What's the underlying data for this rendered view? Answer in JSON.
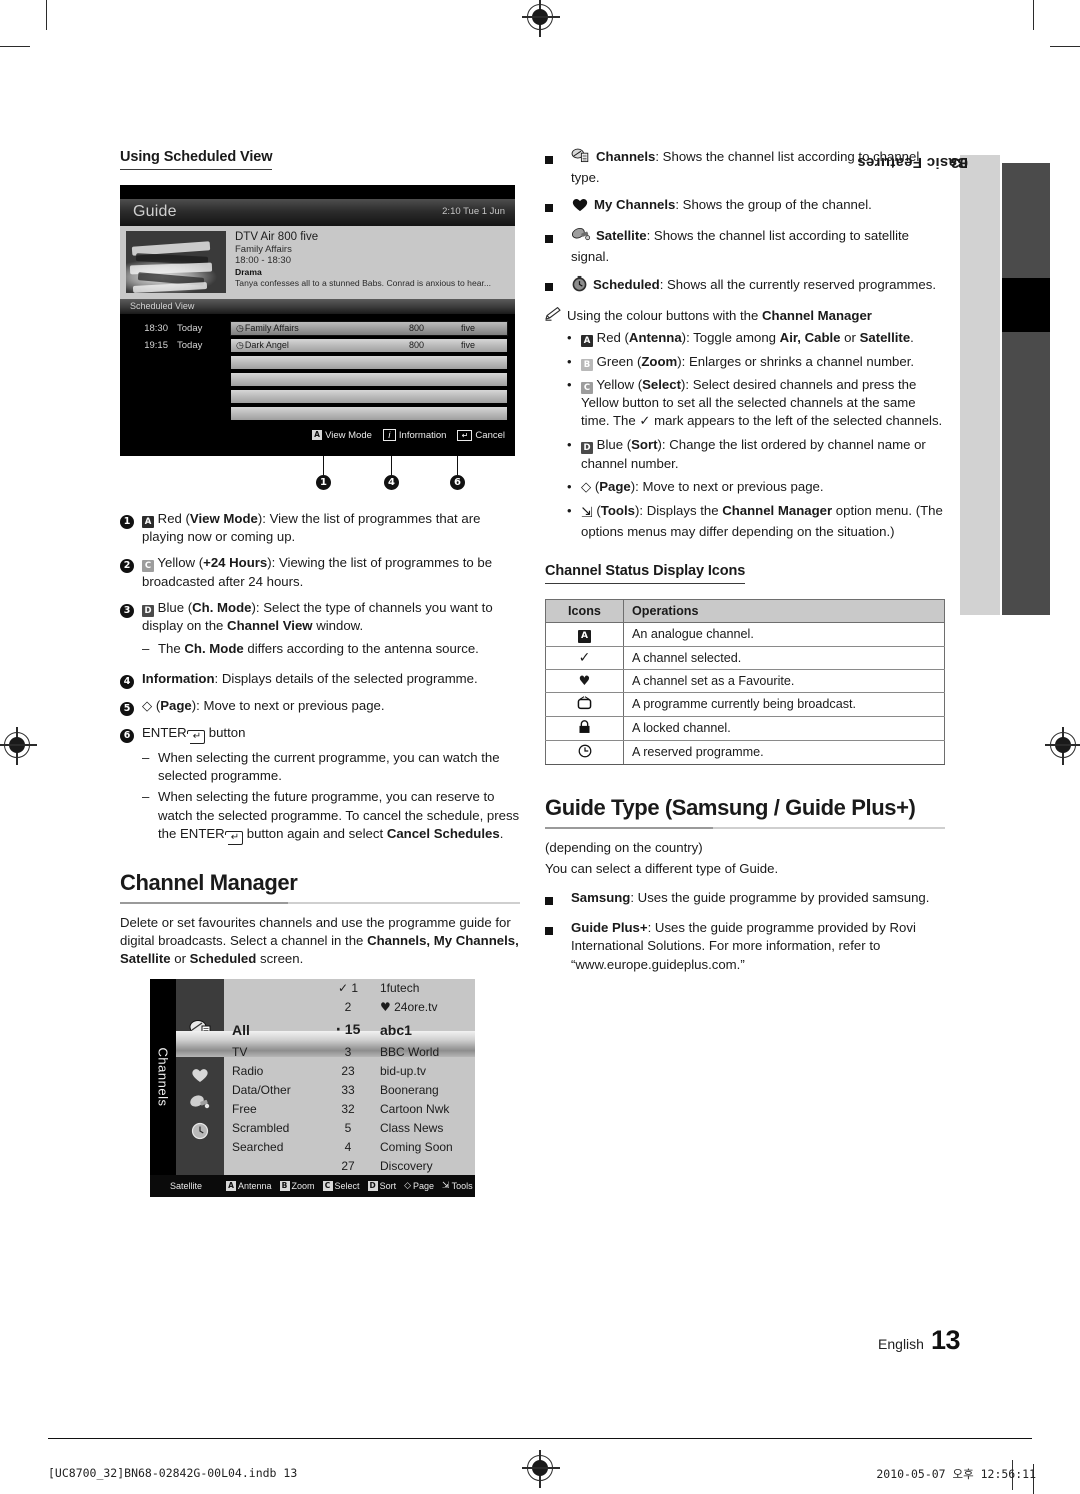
{
  "page": {
    "language_label": "English",
    "page_number": "13",
    "side_tab": {
      "chapter_number": "03",
      "chapter_title": "Basic Features"
    },
    "footer": {
      "file": "[UC8700_32]BN68-02842G-00L04.indb   13",
      "timestamp": "2010-05-07   오후 12:56:11"
    }
  },
  "left": {
    "section_heading": "Using Scheduled View",
    "guide_screenshot": {
      "title": "Guide",
      "clock": "2:10 Tue 1 Jun",
      "program": {
        "channel": "DTV Air 800 five",
        "name": "Family Affairs",
        "time": "18:00 - 18:30",
        "genre": "Drama",
        "description": "Tanya confesses all to a stunned Babs. Conrad is anxious to hear..."
      },
      "list_bar": "Scheduled View",
      "rows": [
        {
          "time": "18:30",
          "day": "Today",
          "program": "Family Affairs",
          "number": "800",
          "channel": "five",
          "selected": true
        },
        {
          "time": "19:15",
          "day": "Today",
          "program": "Dark Angel",
          "number": "800",
          "channel": "five",
          "selected": false
        }
      ],
      "footer_keys": [
        {
          "key": "A",
          "label": "View Mode"
        },
        {
          "key": "i",
          "label": "Information"
        },
        {
          "key": "E",
          "label": "Cancel"
        }
      ],
      "callouts": [
        "1",
        "4",
        "6"
      ]
    },
    "numbered_items": [
      {
        "n": "1",
        "html": "<span class=\"keybox k-red\">A</span> Red (<b>View Mode</b>): View the list of programmes that are playing now or coming up."
      },
      {
        "n": "2",
        "html": "<span class=\"keybox k-yellow\">C</span> Yellow (<b>+24 Hours</b>): Viewing the list of programmes to be broadcasted after 24 hours."
      },
      {
        "n": "3",
        "html": "<span class=\"keybox k-blue\">D</span> Blue (<b>Ch. Mode</b>): Select the type of channels you want to display on the <b>Channel View</b> window.",
        "sub": [
          "The <b>Ch. Mode</b> differs according to the antenna source."
        ]
      },
      {
        "n": "4",
        "html": "<b>Information</b>: Displays details of the selected programme."
      },
      {
        "n": "5",
        "html": "<span class=\"glyph\">&#9671;</span> (<b>Page</b>): Move to next or previous page."
      },
      {
        "n": "6",
        "html": "ENTER<span class=\"enterkey\">&#8629;</span> button",
        "sub": [
          "When selecting the current programme, you can watch the selected programme.",
          "When selecting the future programme, you can reserve to watch the selected programme. To cancel the schedule, press the ENTER<span class=\"enterkey\">&#8629;</span> button again and select <b>Cancel Schedules</b>."
        ]
      }
    ],
    "channel_manager": {
      "heading": "Channel Manager",
      "intro_html": "Delete or set favourites channels and use the programme guide for digital broadcasts. Select a channel in the <b>Channels, My Channels, Satellite</b> or <b>Scheduled</b> screen."
    },
    "channels_screenshot": {
      "tab_label": "Channels",
      "filters": [
        "All",
        "TV",
        "Radio",
        "Data/Other",
        "Free",
        "Scrambled",
        "Searched"
      ],
      "selected_filter": "All",
      "channels": [
        {
          "mark": "check",
          "number": "1",
          "name": "1futech"
        },
        {
          "mark": "heart",
          "number": "2",
          "name": "24ore.tv"
        },
        {
          "mark": "dot",
          "number": "15",
          "name": "abc1"
        },
        {
          "mark": "",
          "number": "3",
          "name": "BBC World"
        },
        {
          "mark": "",
          "number": "23",
          "name": "bid-up.tv"
        },
        {
          "mark": "",
          "number": "33",
          "name": "Boonerang"
        },
        {
          "mark": "",
          "number": "32",
          "name": "Cartoon Nwk"
        },
        {
          "mark": "",
          "number": "5",
          "name": "Class News"
        },
        {
          "mark": "",
          "number": "4",
          "name": "Coming Soon"
        },
        {
          "mark": "",
          "number": "27",
          "name": "Discovery"
        }
      ],
      "selected_channel": "abc1",
      "footer_source": "Satellite",
      "footer_keys": [
        {
          "key": "A",
          "label": "Antenna"
        },
        {
          "key": "B",
          "label": "Zoom"
        },
        {
          "key": "C",
          "label": "Select"
        },
        {
          "key": "D",
          "label": "Sort"
        },
        {
          "key": "P",
          "label": "Page"
        },
        {
          "key": "T",
          "label": "Tools"
        }
      ]
    }
  },
  "right": {
    "manager_modes": [
      {
        "icon": "channels-icon",
        "html": "<b>Channels</b>: Shows the channel list according to channel type."
      },
      {
        "icon": "heart-icon",
        "html": "<b>My Channels</b>: Shows the group of the channel."
      },
      {
        "icon": "satellite-icon",
        "html": "<b>Satellite</b>: Shows the channel list according to satellite signal."
      },
      {
        "icon": "clock-icon",
        "html": "<b>Scheduled</b>: Shows all the currently reserved programmes."
      }
    ],
    "note_heading_html": "Using the colour buttons with the <b>Channel Manager</b>",
    "colour_buttons": [
      "<span class=\"keybox k-red\">A</span> Red (<b>Antenna</b>): Toggle among <b>Air, Cable</b> or <b>Satellite</b>.",
      "<span class=\"keybox k-green\">B</span> Green (<b>Zoom</b>): Enlarges or shrinks a channel number.",
      "<span class=\"keybox k-yellow\">C</span> Yellow (<b>Select</b>): Select desired channels and press the Yellow button to set all the selected channels at the same time. The <span class=\"glyph\">&#10003;</span> mark appears to the left of the selected channels.",
      "<span class=\"keybox k-blue\">D</span> Blue (<b>Sort</b>): Change the list ordered by channel name or channel number.",
      "<span class=\"glyph\">&#9671;</span> (<b>Page</b>): Move to next or previous page.",
      "<span class=\"tools-ico glyph\">&#8690;</span> (<b>Tools</b>): Displays the <b>Channel Manager</b> option menu. (The options menus may differ depending on the situation.)"
    ],
    "status_icons": {
      "heading": "Channel Status Display Icons",
      "columns": [
        "Icons",
        "Operations"
      ],
      "rows": [
        {
          "icon": "A",
          "icon_name": "analogue-icon",
          "operation": "An analogue channel."
        },
        {
          "icon": "✓",
          "icon_name": "check-icon",
          "operation": "A channel selected."
        },
        {
          "icon": "♥",
          "icon_name": "heart-icon",
          "operation": "A channel set as a Favourite."
        },
        {
          "icon": "὏A",
          "icon_name": "tv-icon",
          "operation": "A programme currently being broadcast."
        },
        {
          "icon": "ὑ2",
          "icon_name": "lock-icon",
          "operation": "A locked channel."
        },
        {
          "icon": "◴",
          "icon_name": "clock-icon",
          "operation": "A reserved programme."
        }
      ]
    },
    "guide_type": {
      "heading": "Guide Type (Samsung / Guide Plus+)",
      "note": "(depending on the country)",
      "intro": "You can select a different type of Guide.",
      "items": [
        "<b>Samsung</b>: Uses the guide programme by provided samsung.",
        "<b>Guide Plus+</b>: Uses the guide programme provided by Rovi International Solutions. For more information, refer to “www.europe.guideplus.com.”"
      ]
    }
  }
}
